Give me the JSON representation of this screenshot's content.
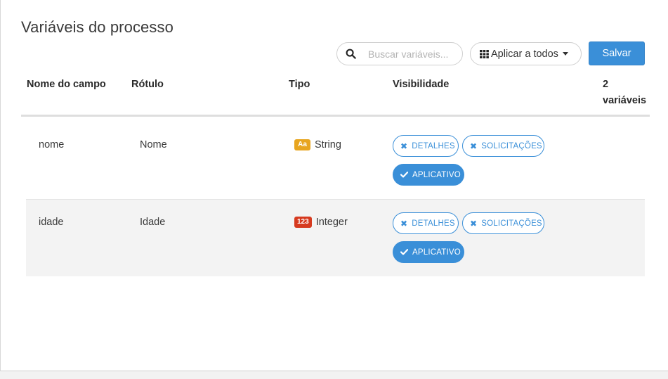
{
  "page": {
    "title": "Variáveis do processo"
  },
  "toolbar": {
    "search_placeholder": "Buscar variáveis...",
    "search_icon": "search-icon",
    "apply_all_label": "Aplicar a todos",
    "apply_all_icon": "grid-icon",
    "save_label": "Salvar",
    "accent_color": "#3a8fd8"
  },
  "table": {
    "headers": {
      "field_name": "Nome do campo",
      "label": "Rótulo",
      "type": "Tipo",
      "visibility": "Visibilidade",
      "count_line1": "2",
      "count_line2": "variáveis"
    },
    "rows": [
      {
        "name": "nome",
        "label": "Nome",
        "type_badge": "Aa",
        "type_badge_color": "#e8a51f",
        "type": "String",
        "visibility": {
          "details": "DETALHES",
          "requests": "SOLICITAÇÕES",
          "app": "APLICATIVO"
        }
      },
      {
        "name": "idade",
        "label": "Idade",
        "type_badge": "123",
        "type_badge_color": "#d63a1f",
        "type": "Integer",
        "visibility": {
          "details": "DETALHES",
          "requests": "SOLICITAÇÕES",
          "app": "APLICATIVO"
        }
      }
    ]
  }
}
